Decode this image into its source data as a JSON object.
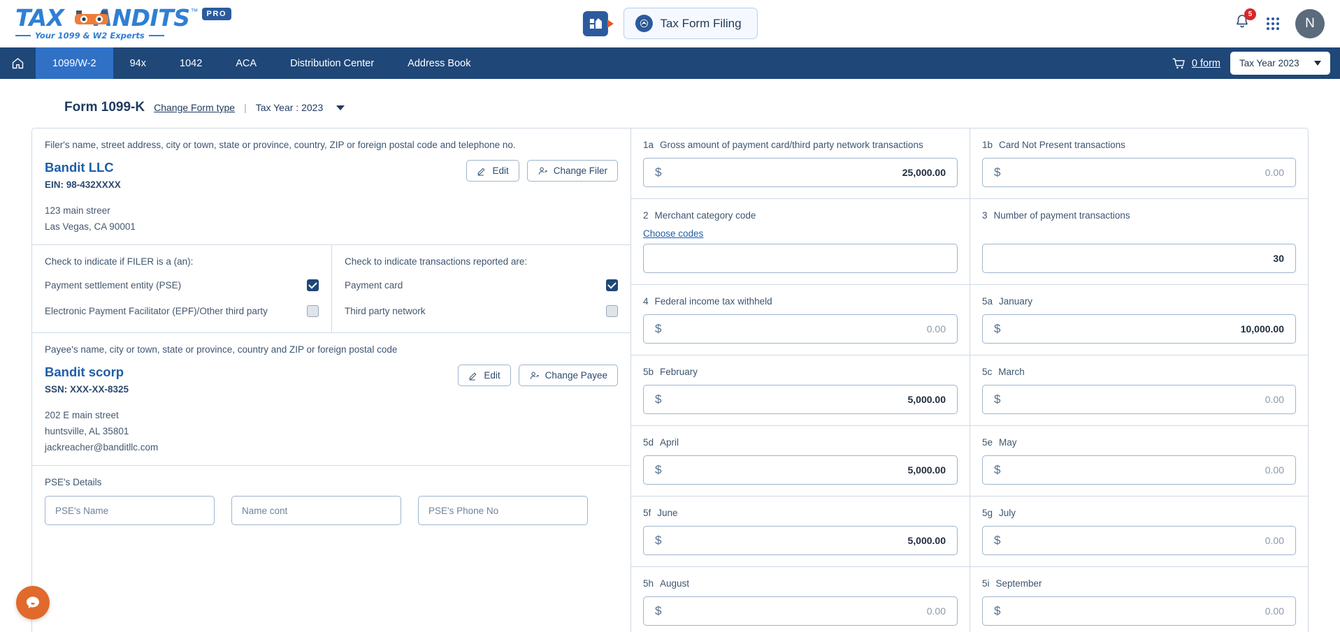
{
  "brand": {
    "logo_text_a": "TAX",
    "logo_text_b": "ANDITS",
    "tm": "™",
    "pro": "PRO",
    "tagline": "Your 1099 & W2 Experts"
  },
  "header": {
    "app_switcher_icon": "apps-building-icon",
    "tax_form_filing_label": "Tax Form Filing",
    "irs_seal_icon": "irs-seal-icon",
    "bell_icon": "bell-icon",
    "bell_badge": "5",
    "grid_icon": "grid-apps-icon",
    "avatar_initial": "N"
  },
  "nav": {
    "home_icon": "home-icon",
    "items": [
      {
        "label": "1099/W-2",
        "active": true
      },
      {
        "label": "94x",
        "active": false
      },
      {
        "label": "1042",
        "active": false
      },
      {
        "label": "ACA",
        "active": false
      },
      {
        "label": "Distribution Center",
        "active": false
      },
      {
        "label": "Address Book",
        "active": false
      }
    ],
    "cart_icon": "cart-icon",
    "cart_label": "0 form",
    "tax_year_value": "Tax Year 2023"
  },
  "form_head": {
    "title": "Form 1099-K",
    "change_form_type": "Change Form type",
    "separator": "|",
    "tax_year": "Tax Year : 2023"
  },
  "filer": {
    "section_label": "Filer's name, street address, city or town, state or province, country, ZIP or foreign postal code and telephone no.",
    "name": "Bandit LLC",
    "id": "EIN: 98-432XXXX",
    "address_line1": "123 main streer",
    "address_line2": "Las Vegas, CA 90001",
    "edit_label": "Edit",
    "change_label": "Change Filer"
  },
  "payee": {
    "section_label": "Payee's name, city or town, state or province, country and ZIP or foreign postal code",
    "name": "Bandit scorp",
    "id": "SSN: XXX-XX-8325",
    "address_line1": "202 E main street",
    "address_line2": "huntsville, AL 35801",
    "address_line3": "jackreacher@banditllc.com",
    "edit_label": "Edit",
    "change_label": "Change Payee"
  },
  "filer_checks": {
    "title": "Check to indicate if FILER is a (an):",
    "items": [
      {
        "label": "Payment settlement entity (PSE)",
        "checked": true
      },
      {
        "label": "Electronic Payment Facilitator (EPF)/Other third party",
        "checked": false
      }
    ]
  },
  "transaction_checks": {
    "title": "Check to indicate transactions reported are:",
    "items": [
      {
        "label": "Payment card",
        "checked": true
      },
      {
        "label": "Third party network",
        "checked": false
      }
    ]
  },
  "pse_details": {
    "title": "PSE's Details",
    "fields": [
      {
        "placeholder": "PSE's Name",
        "value": ""
      },
      {
        "placeholder": "Name cont",
        "value": ""
      },
      {
        "placeholder": "PSE's Phone No",
        "value": ""
      }
    ]
  },
  "boxes": [
    [
      {
        "num": "1a",
        "label": "Gross amount of payment card/third party network transactions",
        "type": "money",
        "value": "25,000.00",
        "filled": true
      },
      {
        "num": "1b",
        "label": "Card Not Present transactions",
        "type": "money",
        "value": "0.00",
        "filled": false
      }
    ],
    [
      {
        "num": "2",
        "label": "Merchant category code",
        "type": "plain",
        "value": "",
        "filled": false,
        "link": "Choose codes"
      },
      {
        "num": "3",
        "label": "Number of payment transactions",
        "type": "plain",
        "value": "30",
        "filled": true
      }
    ],
    [
      {
        "num": "4",
        "label": "Federal income tax withheld",
        "type": "money",
        "value": "0.00",
        "filled": false
      },
      {
        "num": "5a",
        "label": "January",
        "type": "money",
        "value": "10,000.00",
        "filled": true
      }
    ],
    [
      {
        "num": "5b",
        "label": "February",
        "type": "money",
        "value": "5,000.00",
        "filled": true
      },
      {
        "num": "5c",
        "label": "March",
        "type": "money",
        "value": "0.00",
        "filled": false
      }
    ],
    [
      {
        "num": "5d",
        "label": "April",
        "type": "money",
        "value": "5,000.00",
        "filled": true
      },
      {
        "num": "5e",
        "label": "May",
        "type": "money",
        "value": "0.00",
        "filled": false
      }
    ],
    [
      {
        "num": "5f",
        "label": "June",
        "type": "money",
        "value": "5,000.00",
        "filled": true
      },
      {
        "num": "5g",
        "label": "July",
        "type": "money",
        "value": "0.00",
        "filled": false
      }
    ],
    [
      {
        "num": "5h",
        "label": "August",
        "type": "money",
        "value": "0.00",
        "filled": false
      },
      {
        "num": "5i",
        "label": "September",
        "type": "money",
        "value": "0.00",
        "filled": false
      }
    ]
  ],
  "chat": {
    "icon": "chat-bubble-icon"
  },
  "colors": {
    "nav_blue": "#1f4778",
    "nav_active": "#3071c6",
    "brand_blue": "#2f7fd4",
    "accent_orange": "#e2692c",
    "badge_red": "#d62828"
  }
}
